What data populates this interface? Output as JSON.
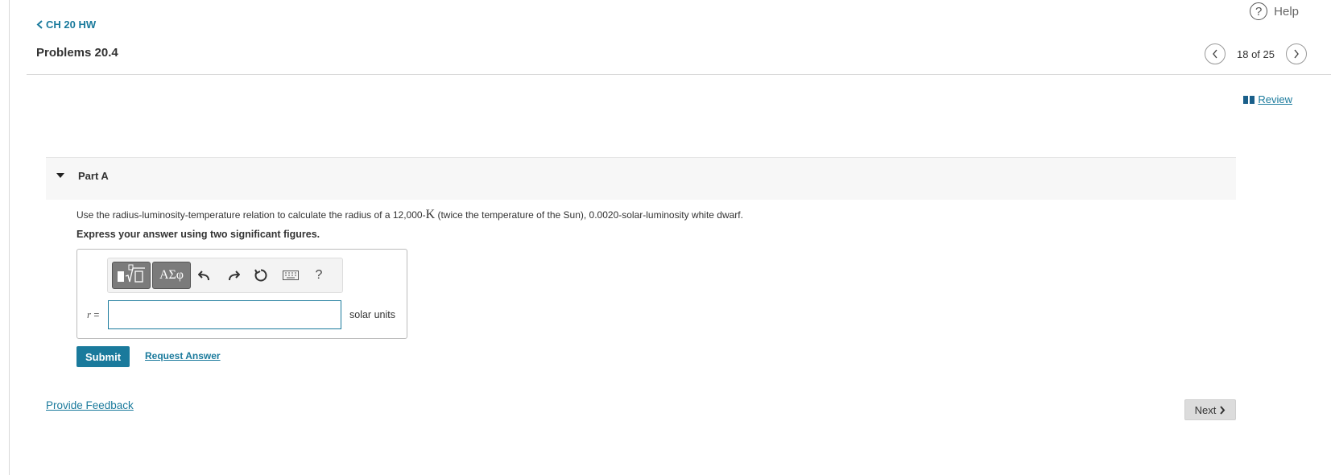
{
  "header": {
    "help_label": "Help",
    "help_glyph": "?",
    "back_label": "CH 20 HW",
    "title": "Problems 20.4",
    "pager_text": "18 of 25",
    "review_label": "Review"
  },
  "part": {
    "title": "Part A",
    "question_before": "Use the radius-luminosity-temperature relation to calculate the radius of a 12,000-",
    "question_unit": "K",
    "question_after": " (twice the temperature of the Sun), 0.0020-solar-luminosity white dwarf.",
    "instruction": "Express your answer using two significant figures."
  },
  "toolbar": {
    "greek_label": "ΑΣφ",
    "help_glyph": "?"
  },
  "answer": {
    "variable": "r",
    "equals": " =",
    "value": "",
    "units": "solar units"
  },
  "actions": {
    "submit_label": "Submit",
    "request_label": "Request Answer",
    "feedback_label": "Provide Feedback",
    "next_label": "Next"
  },
  "colors": {
    "accent": "#1a7a9c",
    "toolbar_button": "#7b7b7b",
    "next_button": "#dcdcdc"
  }
}
